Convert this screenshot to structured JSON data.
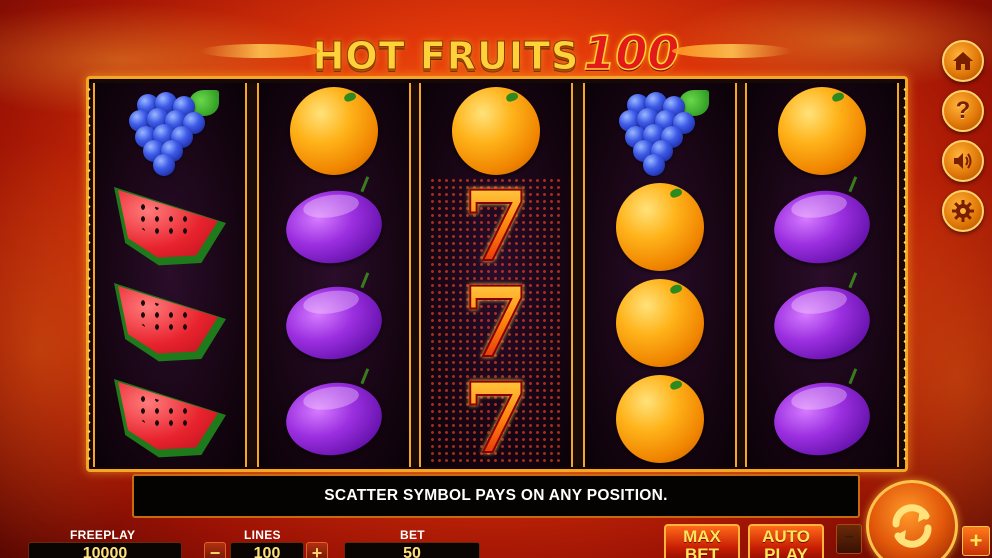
{
  "logo": {
    "text": "HOT FRUITS",
    "number": "100"
  },
  "reels": [
    [
      "grapes",
      "watermelon",
      "watermelon",
      "watermelon"
    ],
    [
      "orange",
      "plum",
      "plum",
      "plum"
    ],
    [
      "orange",
      "seven",
      "seven",
      "seven"
    ],
    [
      "grapes",
      "orange",
      "orange",
      "orange"
    ],
    [
      "orange",
      "plum",
      "plum",
      "plum"
    ]
  ],
  "seven_glyph": "7",
  "message": "SCATTER SYMBOL PAYS ON ANY POSITION.",
  "side_buttons": [
    {
      "name": "home-button",
      "icon": "home-icon"
    },
    {
      "name": "help-button",
      "icon": "question-icon",
      "glyph": "?"
    },
    {
      "name": "sound-button",
      "icon": "speaker-icon"
    },
    {
      "name": "settings-button",
      "icon": "gear-icon"
    }
  ],
  "controls": {
    "freeplay_label": "FREEPLAY",
    "freeplay_value": "10000",
    "lines_label": "LINES",
    "lines_value": "100",
    "lines_minus": "−",
    "lines_plus": "+",
    "bet_label": "BET",
    "bet_value": "50",
    "max_bet_line1": "MAX",
    "max_bet_line2": "BET",
    "auto_play_line1": "AUTO",
    "auto_play_line2": "PLAY",
    "minus": "−",
    "plus": "+"
  },
  "colors": {
    "frame": "#f5a623",
    "message_text": "#ffffff",
    "accent_red": "#e21a1a",
    "gold": "#ffd23a"
  }
}
